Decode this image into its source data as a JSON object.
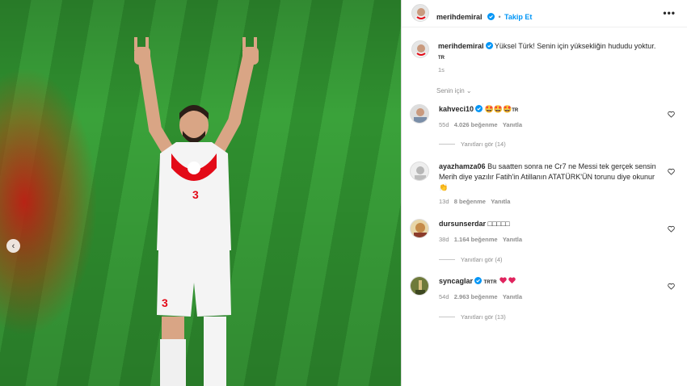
{
  "post": {
    "username": "merihdemiral",
    "follow_label": "Takip Et",
    "separator": "•",
    "more_label": "•••",
    "caption": "Yüksel Türk! Senin için yüksekliğin hududu yoktur.",
    "caption_tag": "TR",
    "time_ago": "1s",
    "sort_label": "Senin için"
  },
  "comments": [
    {
      "username": "kahveci10",
      "text": "🤩🤩🤩",
      "tag": "TR",
      "time": "55d",
      "likes": "4.026 beğenme",
      "reply_label": "Yanıtla",
      "replies": "Yanıtları gör (14)"
    },
    {
      "username": "ayazhamza06",
      "text": "Bu saatten sonra ne Cr7 ne Messi tek gerçek sensin Merih diye yazılır Fatih'in Atillanın ATATÜRK'ÜN torunu diye okunur 👏",
      "tag": "",
      "time": "13d",
      "likes": "8 beğenme",
      "reply_label": "Yanıtla",
      "replies": ""
    },
    {
      "username": "dursunserdar",
      "text": "□□□□□",
      "tag": "",
      "time": "38d",
      "likes": "1.164 beğenme",
      "reply_label": "Yanıtla",
      "replies": "Yanıtları gör (4)"
    },
    {
      "username": "syncaglar",
      "text": "",
      "tag": "TRTR",
      "time": "54d",
      "likes": "2.963 beğenme",
      "reply_label": "Yanıtla",
      "replies": "Yanıtları gör (13)"
    }
  ],
  "colors": {
    "link": "#0095f6",
    "verified": "#0095f6",
    "heart": "#e0245e"
  },
  "nav": {
    "prev_icon": "‹"
  }
}
